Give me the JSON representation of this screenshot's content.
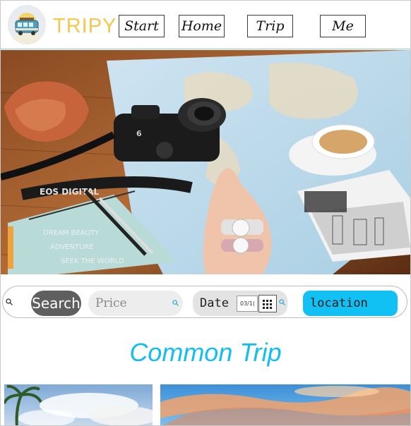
{
  "header": {
    "brand": "TRIPY",
    "nav": [
      {
        "label": "Start"
      },
      {
        "label": "Home"
      },
      {
        "label": "Trip"
      },
      {
        "label": "Me"
      }
    ]
  },
  "search": {
    "button_label": "Search",
    "price_placeholder": "Price",
    "date_label": "Date",
    "date_value": "03/1(",
    "location_label": "location"
  },
  "section": {
    "title": "Common Trip"
  },
  "colors": {
    "brand": "#f4c84b",
    "accent": "#11c1f4",
    "title": "#12bdf2",
    "search_button": "#5f5f5f"
  },
  "icons": [
    "van-logo-icon",
    "search-icon",
    "calendar-icon"
  ]
}
